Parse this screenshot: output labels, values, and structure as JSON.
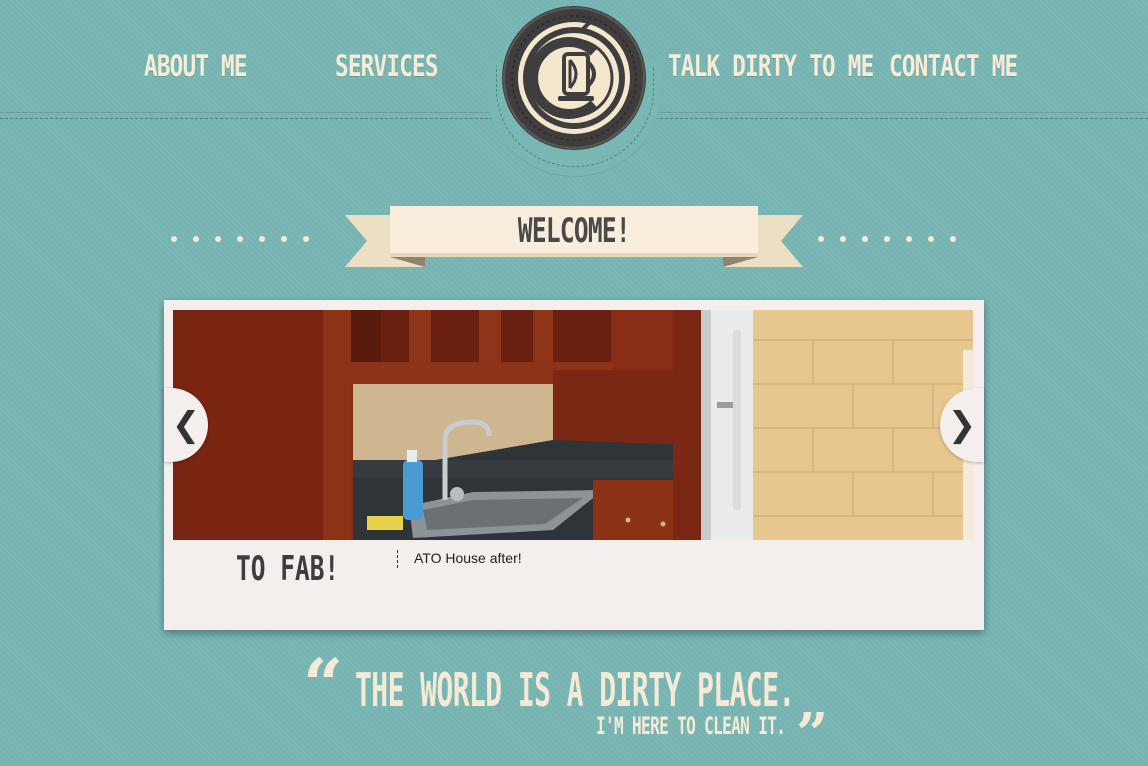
{
  "nav": {
    "items": [
      {
        "label": "ABOUT ME"
      },
      {
        "label": "SERVICES"
      },
      {
        "label": "TALK DIRTY TO ME"
      },
      {
        "label": "CONTACT ME"
      }
    ]
  },
  "logo": {
    "icon": "coffee-cup-cd-monogram-icon"
  },
  "welcome": {
    "label": "WELCOME!"
  },
  "slider": {
    "heading": "TO FAB!",
    "caption": "ATO House after!",
    "prev_icon": "chevron-left-icon",
    "next_icon": "chevron-right-icon",
    "prev_glyph": "❮",
    "next_glyph": "❯"
  },
  "quote": {
    "open_mark": "“",
    "line1": "THE WORLD IS A DIRTY PLACE.",
    "line2": "I'M HERE TO CLEAN IT.",
    "close_mark": "”"
  },
  "colors": {
    "background": "#79b7b4",
    "cream": "#f4ead5",
    "dark": "#4a4848"
  }
}
